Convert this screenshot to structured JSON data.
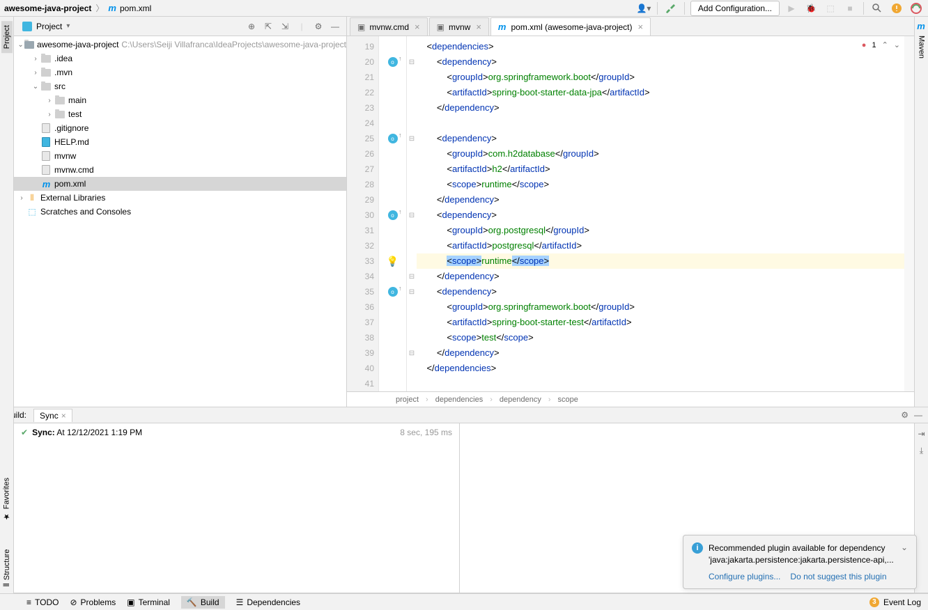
{
  "breadcrumb": {
    "root": "awesome-java-project",
    "file": "pom.xml"
  },
  "toolbar": {
    "addConfig": "Add Configuration..."
  },
  "sidebar": {
    "projectTab": "Project",
    "mavenTab": "Maven"
  },
  "projectView": {
    "title": "Project",
    "root": {
      "name": "awesome-java-project",
      "path": "C:\\Users\\Seiji Villafranca\\IdeaProjects\\awesome-java-project"
    },
    "items": {
      "idea": ".idea",
      "mvn": ".mvn",
      "src": "src",
      "main": "main",
      "test": "test",
      "gitignore": ".gitignore",
      "help": "HELP.md",
      "mvnw": "mvnw",
      "mvnwcmd": "mvnw.cmd",
      "pom": "pom.xml",
      "extlib": "External Libraries",
      "scratches": "Scratches and Consoles"
    }
  },
  "editorTabs": {
    "t1": "mvnw.cmd",
    "t2": "mvnw",
    "t3": "pom.xml (awesome-java-project)"
  },
  "errors": {
    "count": "1"
  },
  "lineNumbers": [
    "19",
    "20",
    "21",
    "22",
    "23",
    "24",
    "25",
    "26",
    "27",
    "28",
    "29",
    "30",
    "31",
    "32",
    "33",
    "34",
    "35",
    "36",
    "37",
    "38",
    "39",
    "40",
    "41"
  ],
  "code": {
    "l19": {
      "open": "<",
      "tag": "dependencies",
      "close": ">"
    },
    "l20": {
      "open": "<",
      "tag": "dependency",
      "close": ">"
    },
    "l21": {
      "open": "<",
      "tag1": "groupId",
      "mid": ">",
      "txt": "org.springframework.boot",
      "closeo": "</",
      "tag2": "groupId",
      "close": ">"
    },
    "l22": {
      "open": "<",
      "tag1": "artifactId",
      "mid": ">",
      "txt": "spring-boot-starter-data-jpa",
      "closeo": "</",
      "tag2": "artifactId",
      "close": ">"
    },
    "l23": {
      "open": "</",
      "tag": "dependency",
      "close": ">"
    },
    "l25": {
      "open": "<",
      "tag": "dependency",
      "close": ">"
    },
    "l26": {
      "open": "<",
      "tag1": "groupId",
      "mid": ">",
      "txt": "com.h2database",
      "closeo": "</",
      "tag2": "groupId",
      "close": ">"
    },
    "l27": {
      "open": "<",
      "tag1": "artifactId",
      "mid": ">",
      "txt": "h2",
      "closeo": "</",
      "tag2": "artifactId",
      "close": ">"
    },
    "l28": {
      "open": "<",
      "tag1": "scope",
      "mid": ">",
      "txt": "runtime",
      "closeo": "</",
      "tag2": "scope",
      "close": ">"
    },
    "l29": {
      "open": "</",
      "tag": "dependency",
      "close": ">"
    },
    "l30": {
      "open": "<",
      "tag": "dependency",
      "close": ">"
    },
    "l31": {
      "open": "<",
      "tag1": "groupId",
      "mid": ">",
      "txt": "org.postgresql",
      "closeo": "</",
      "tag2": "groupId",
      "close": ">"
    },
    "l32": {
      "open": "<",
      "tag1": "artifactId",
      "mid": ">",
      "txt": "postgresql",
      "closeo": "</",
      "tag2": "artifactId",
      "close": ">"
    },
    "l33": {
      "open": "<",
      "tag1": "scope",
      "mid": ">",
      "txt": "runtime",
      "closeo": "</",
      "tag2": "scope",
      "close": ">"
    },
    "l34": {
      "open": "</",
      "tag": "dependency",
      "close": ">"
    },
    "l35": {
      "open": "<",
      "tag": "dependency",
      "close": ">"
    },
    "l36": {
      "open": "<",
      "tag1": "groupId",
      "mid": ">",
      "txt": "org.springframework.boot",
      "closeo": "</",
      "tag2": "groupId",
      "close": ">"
    },
    "l37": {
      "open": "<",
      "tag1": "artifactId",
      "mid": ">",
      "txt": "spring-boot-starter-test",
      "closeo": "</",
      "tag2": "artifactId",
      "close": ">"
    },
    "l38": {
      "open": "<",
      "tag1": "scope",
      "mid": ">",
      "txt": "test",
      "closeo": "</",
      "tag2": "scope",
      "close": ">"
    },
    "l39": {
      "open": "</",
      "tag": "dependency",
      "close": ">"
    },
    "l40": {
      "open": "</",
      "tag": "dependencies",
      "close": ">"
    }
  },
  "bcrumb": {
    "a": "project",
    "b": "dependencies",
    "c": "dependency",
    "d": "scope"
  },
  "build": {
    "label": "Build:",
    "tab": "Sync",
    "sync": "Sync:",
    "at": "At 12/12/2021 1:19 PM",
    "dur": "8 sec, 195 ms"
  },
  "notif": {
    "line1": "Recommended plugin available for dependency",
    "line2": "'java:jakarta.persistence:jakarta.persistence-api,...",
    "link1": "Configure plugins...",
    "link2": "Do not suggest this plugin"
  },
  "status": {
    "todo": "TODO",
    "problems": "Problems",
    "terminal": "Terminal",
    "buildbtn": "Build",
    "deps": "Dependencies",
    "eventlog": "Event Log",
    "structure": "Structure",
    "favorites": "Favorites",
    "badge": "3"
  }
}
